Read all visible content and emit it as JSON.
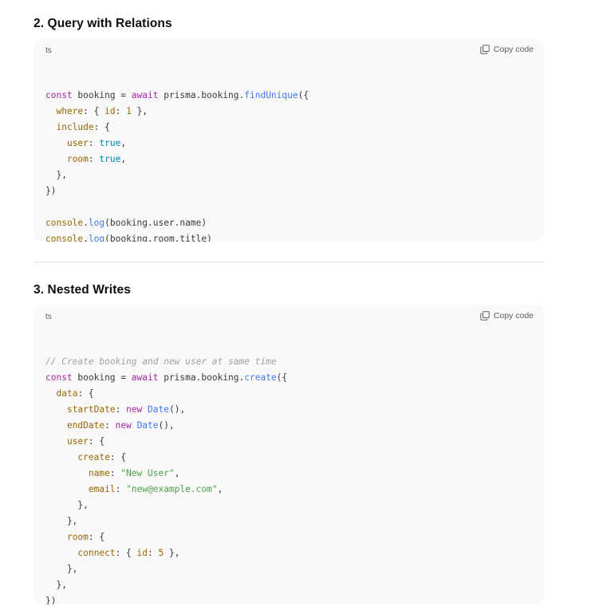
{
  "sections": [
    {
      "title": "2. Query with Relations",
      "code_block": {
        "language": "ts",
        "copy_label": "Copy code",
        "lines": [
          [],
          [
            [
              "kw",
              "const"
            ],
            [
              "ident",
              " booking = "
            ],
            [
              "kw",
              "await"
            ],
            [
              "ident",
              " prisma.booking."
            ],
            [
              "fn",
              "findUnique"
            ],
            [
              "punc",
              "({"
            ]
          ],
          [
            [
              "ident",
              "  "
            ],
            [
              "prop",
              "where"
            ],
            [
              "punc",
              ": { "
            ],
            [
              "prop",
              "id"
            ],
            [
              "punc",
              ": "
            ],
            [
              "num",
              "1"
            ],
            [
              "punc",
              " },"
            ]
          ],
          [
            [
              "ident",
              "  "
            ],
            [
              "prop",
              "include"
            ],
            [
              "punc",
              ": {"
            ]
          ],
          [
            [
              "ident",
              "    "
            ],
            [
              "prop",
              "user"
            ],
            [
              "punc",
              ": "
            ],
            [
              "bool",
              "true"
            ],
            [
              "punc",
              ","
            ]
          ],
          [
            [
              "ident",
              "    "
            ],
            [
              "prop",
              "room"
            ],
            [
              "punc",
              ": "
            ],
            [
              "bool",
              "true"
            ],
            [
              "punc",
              ","
            ]
          ],
          [
            [
              "punc",
              "  },"
            ]
          ],
          [
            [
              "punc",
              "})"
            ]
          ],
          [],
          [
            [
              "prop",
              "console"
            ],
            [
              "punc",
              "."
            ],
            [
              "fn",
              "log"
            ],
            [
              "punc",
              "(booking.user.name)"
            ]
          ],
          [
            [
              "prop",
              "console"
            ],
            [
              "punc",
              "."
            ],
            [
              "fn",
              "log"
            ],
            [
              "punc",
              "(booking.room.title)"
            ]
          ]
        ]
      }
    },
    {
      "title": "3. Nested Writes",
      "code_block": {
        "language": "ts",
        "copy_label": "Copy code",
        "lines": [
          [],
          [
            [
              "cm",
              "// Create booking and new user at same time"
            ]
          ],
          [
            [
              "kw",
              "const"
            ],
            [
              "ident",
              " booking = "
            ],
            [
              "kw",
              "await"
            ],
            [
              "ident",
              " prisma.booking."
            ],
            [
              "fn",
              "create"
            ],
            [
              "punc",
              "({"
            ]
          ],
          [
            [
              "ident",
              "  "
            ],
            [
              "prop",
              "data"
            ],
            [
              "punc",
              ": {"
            ]
          ],
          [
            [
              "ident",
              "    "
            ],
            [
              "prop",
              "startDate"
            ],
            [
              "punc",
              ": "
            ],
            [
              "kw",
              "new"
            ],
            [
              "ident",
              " "
            ],
            [
              "cls",
              "Date"
            ],
            [
              "punc",
              "(),"
            ]
          ],
          [
            [
              "ident",
              "    "
            ],
            [
              "prop",
              "endDate"
            ],
            [
              "punc",
              ": "
            ],
            [
              "kw",
              "new"
            ],
            [
              "ident",
              " "
            ],
            [
              "cls",
              "Date"
            ],
            [
              "punc",
              "(),"
            ]
          ],
          [
            [
              "ident",
              "    "
            ],
            [
              "prop",
              "user"
            ],
            [
              "punc",
              ": {"
            ]
          ],
          [
            [
              "ident",
              "      "
            ],
            [
              "prop",
              "create"
            ],
            [
              "punc",
              ": {"
            ]
          ],
          [
            [
              "ident",
              "        "
            ],
            [
              "prop",
              "name"
            ],
            [
              "punc",
              ": "
            ],
            [
              "str",
              "\"New User\""
            ],
            [
              "punc",
              ","
            ]
          ],
          [
            [
              "ident",
              "        "
            ],
            [
              "prop",
              "email"
            ],
            [
              "punc",
              ": "
            ],
            [
              "str",
              "\"new@example.com\""
            ],
            [
              "punc",
              ","
            ]
          ],
          [
            [
              "punc",
              "      },"
            ]
          ],
          [
            [
              "punc",
              "    },"
            ]
          ],
          [
            [
              "ident",
              "    "
            ],
            [
              "prop",
              "room"
            ],
            [
              "punc",
              ": {"
            ]
          ],
          [
            [
              "ident",
              "      "
            ],
            [
              "prop",
              "connect"
            ],
            [
              "punc",
              ": { "
            ],
            [
              "prop",
              "id"
            ],
            [
              "punc",
              ": "
            ],
            [
              "num",
              "5"
            ],
            [
              "punc",
              " },"
            ]
          ],
          [
            [
              "punc",
              "    },"
            ]
          ],
          [
            [
              "punc",
              "  },"
            ]
          ],
          [
            [
              "punc",
              "})"
            ]
          ]
        ]
      }
    }
  ]
}
